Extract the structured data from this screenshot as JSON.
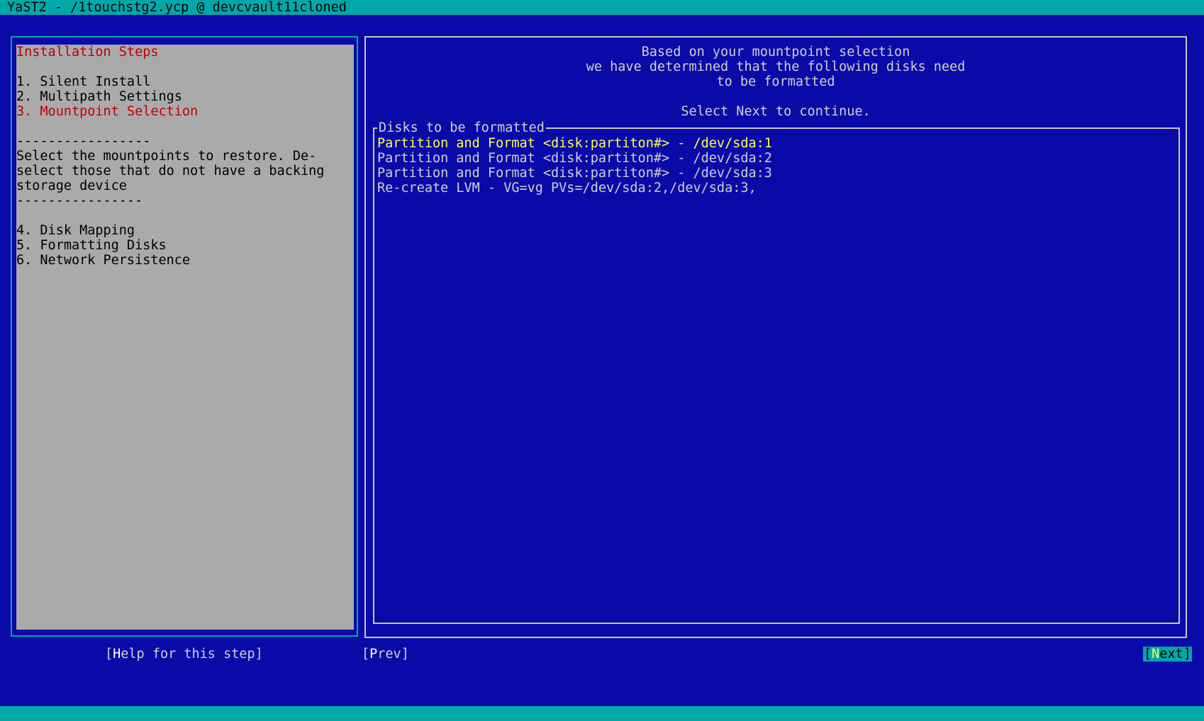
{
  "window": {
    "title": "YaST2 - /1touchstg2.ycp @ devcvault11cloned"
  },
  "sidebar": {
    "heading": "Installation Steps",
    "steps_before": [
      {
        "label": "1. Silent Install"
      },
      {
        "label": "2. Multipath Settings"
      }
    ],
    "current_step": "3. Mountpoint Selection",
    "separator_top": "-----------------",
    "description": "Select the mountpoints to restore. De-select those that do not have a backing storage device",
    "separator_bottom": "----------------",
    "steps_after": [
      {
        "label": "4. Disk Mapping"
      },
      {
        "label": "5. Formatting Disks"
      },
      {
        "label": "6. Network Persistence"
      }
    ]
  },
  "main": {
    "header_lines": [
      "Based on your mountpoint selection",
      "we have determined that the following disks need",
      "to be formatted"
    ],
    "instruction": "Select Next to continue.",
    "frame_label": "Disks to be formatted",
    "items": [
      {
        "text": "Partition and Format <disk:partiton#> - /dev/sda:1"
      },
      {
        "text": "Partition and Format <disk:partiton#> - /dev/sda:2"
      },
      {
        "text": "Partition and Format <disk:partiton#> - /dev/sda:3"
      },
      {
        "text": "Re-create LVM - VG=vg PVs=/dev/sda:2,/dev/sda:3,"
      }
    ],
    "selected_index": 0
  },
  "buttons": {
    "help": {
      "open": "[",
      "hotkey": "H",
      "rest": "elp for this step]"
    },
    "prev": {
      "open": "[",
      "hotkey": "P",
      "rest": "rev]"
    },
    "next": {
      "open": "[",
      "hotkey": "N",
      "rest": "ext]"
    }
  },
  "colors": {
    "background": "#0a0aa8",
    "titlebar": "#00a8a8",
    "panel": "#aaaaaa",
    "current_step": "#c00000",
    "selected_item": "#ffff55"
  }
}
